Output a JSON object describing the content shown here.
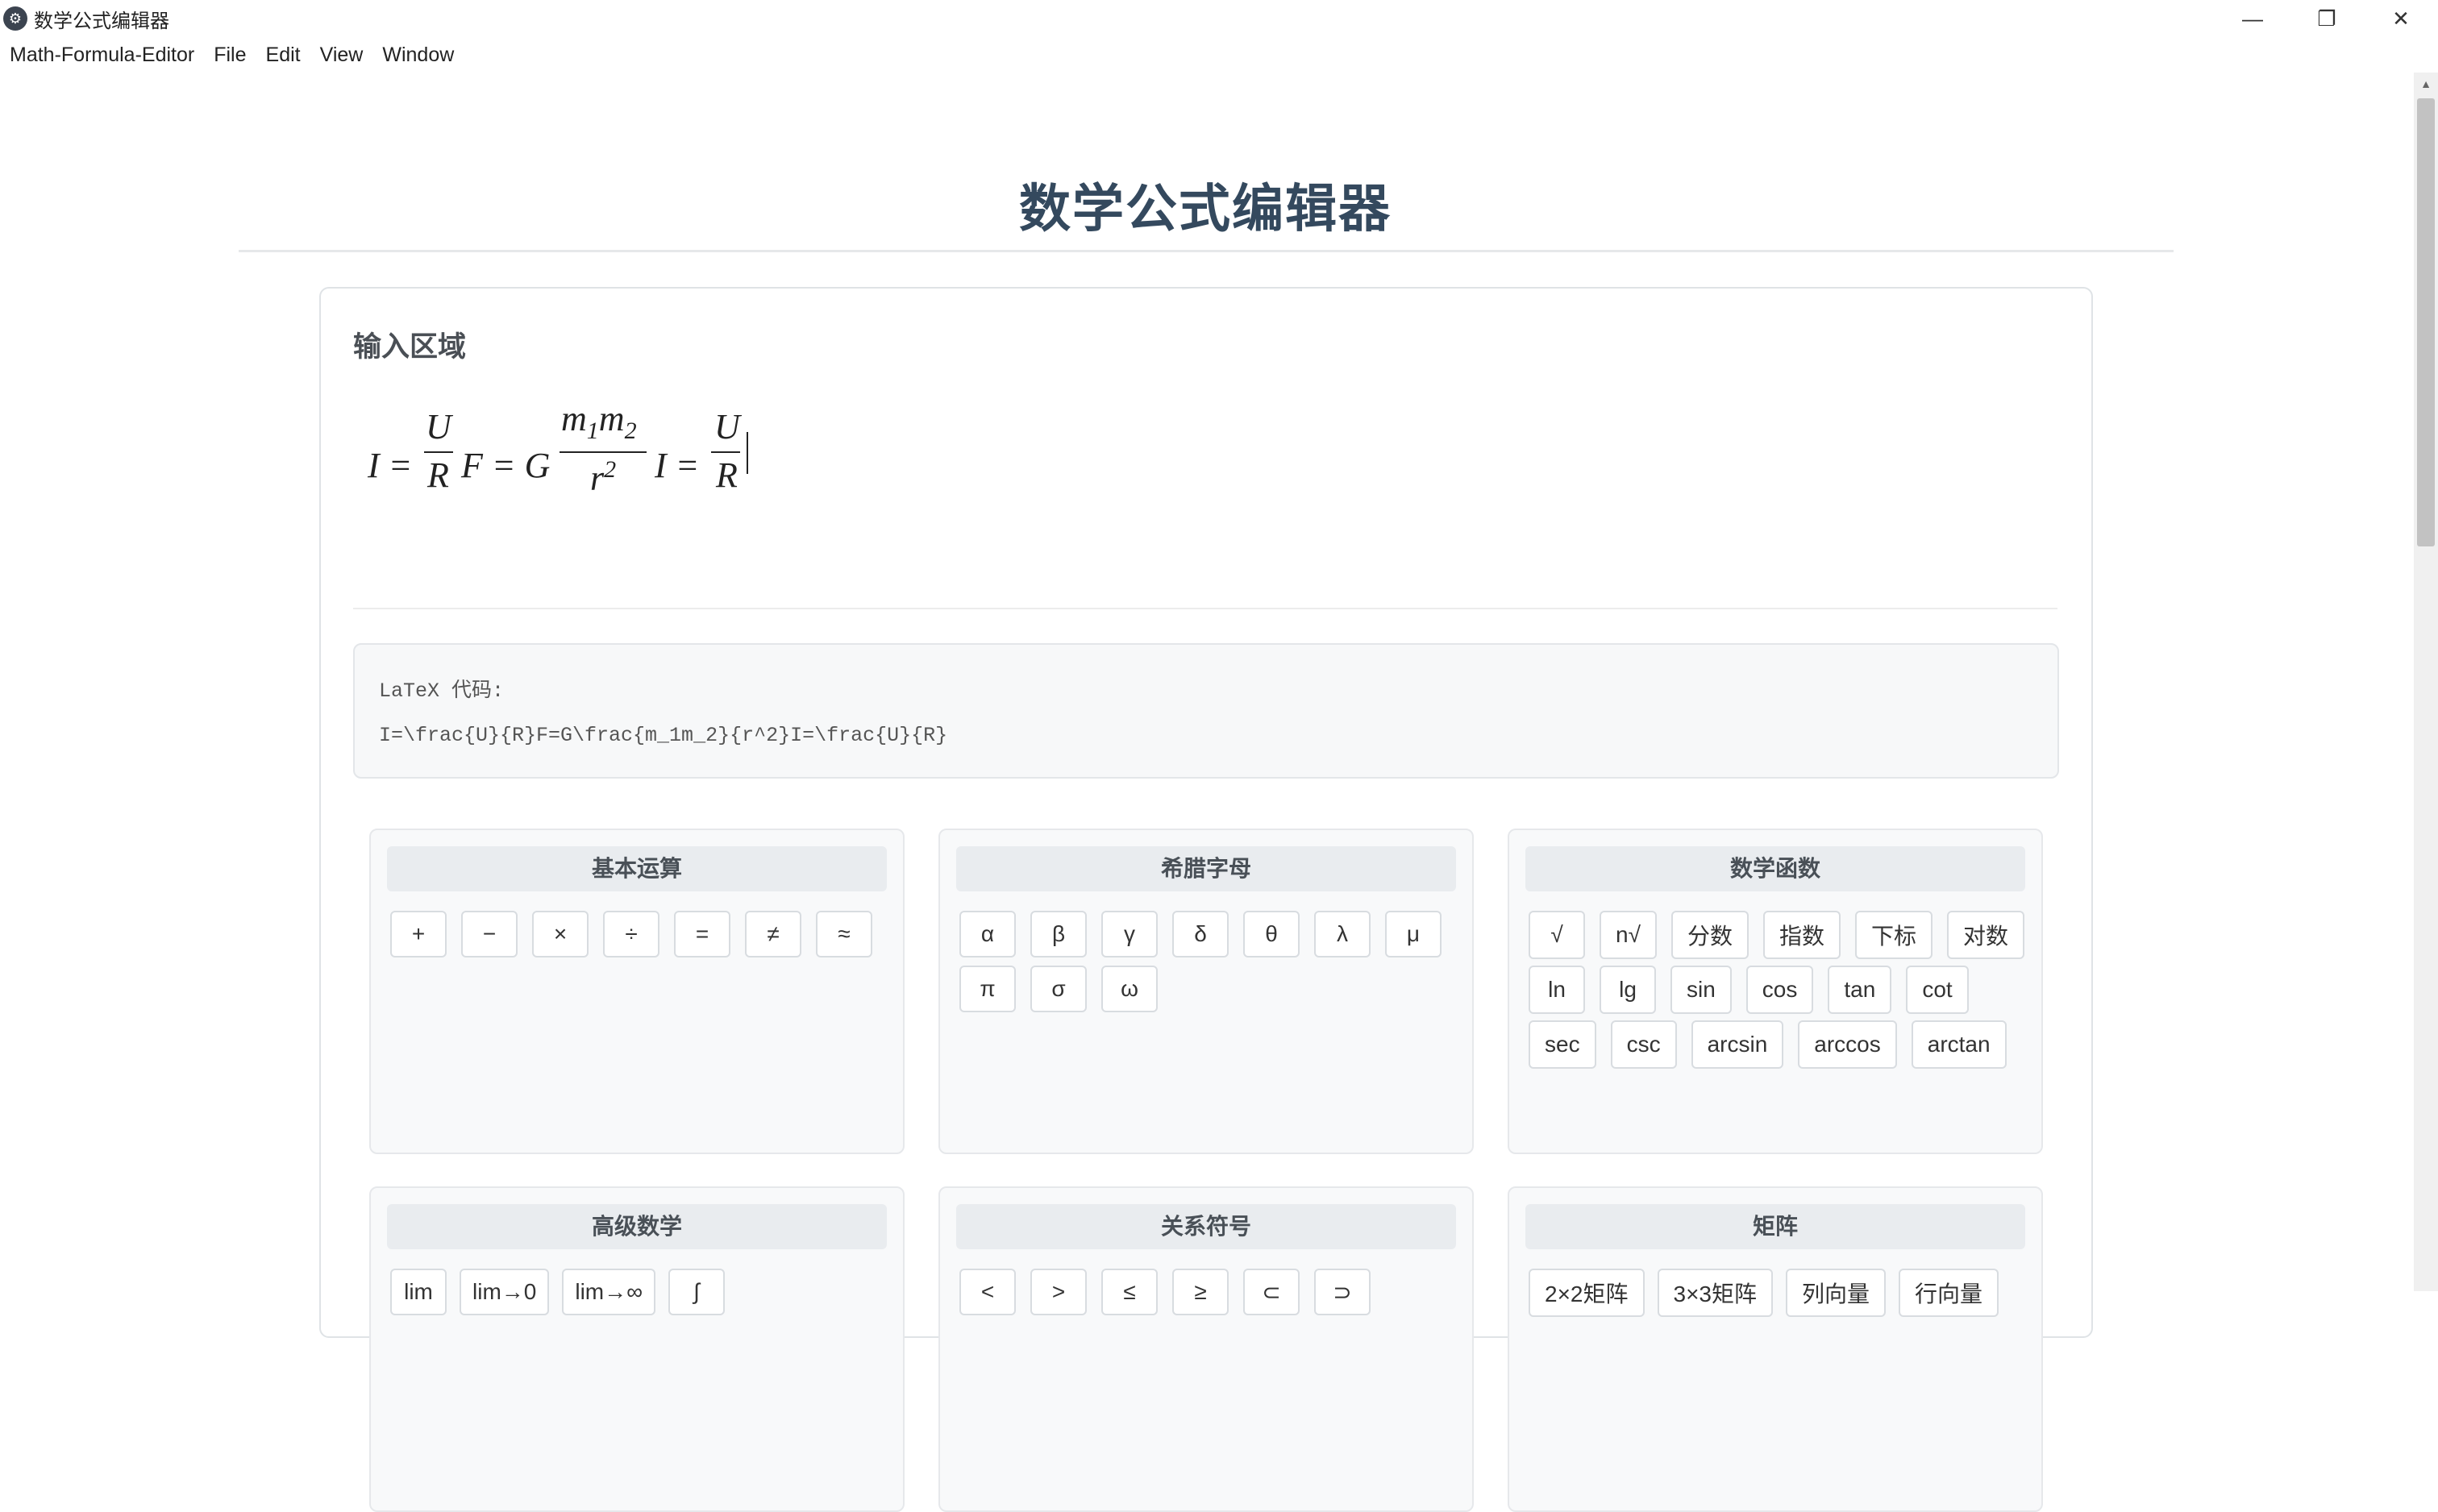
{
  "window": {
    "title": "数学公式编辑器",
    "controls": {
      "minimize": "—",
      "restore": "❐",
      "close": "✕"
    }
  },
  "menubar": {
    "items": [
      "Math-Formula-Editor",
      "File",
      "Edit",
      "View",
      "Window"
    ]
  },
  "page": {
    "title": "数学公式编辑器"
  },
  "input_area": {
    "title": "输入区域",
    "formula": {
      "f1": {
        "lhs": "I =",
        "num": "U",
        "den": "R"
      },
      "f2": {
        "lhs": "F = G",
        "num_m": "m",
        "num_s1": "1",
        "num_m2": "m",
        "num_s2": "2",
        "den_r": "r",
        "den_exp": "2"
      },
      "f3": {
        "lhs": "I =",
        "num": "U",
        "den": "R"
      }
    }
  },
  "latex": {
    "label": "LaTeX 代码:",
    "code": "I=\\frac{U}{R}F=G\\frac{m_1m_2}{r^2}I=\\frac{U}{R}"
  },
  "panels": {
    "basic_ops": {
      "title": "基本运算",
      "buttons": [
        "+",
        "−",
        "×",
        "÷",
        "=",
        "≠",
        "≈"
      ]
    },
    "greek": {
      "title": "希腊字母",
      "buttons": [
        "α",
        "β",
        "γ",
        "δ",
        "θ",
        "λ",
        "μ",
        "π",
        "σ",
        "ω"
      ]
    },
    "functions": {
      "title": "数学函数",
      "buttons": [
        "√",
        "n√",
        "分数",
        "指数",
        "下标",
        "对数",
        "ln",
        "lg",
        "sin",
        "cos",
        "tan",
        "cot",
        "sec",
        "csc",
        "arcsin",
        "arccos",
        "arctan"
      ]
    },
    "advanced": {
      "title": "高级数学",
      "buttons": [
        "lim",
        "lim→0",
        "lim→∞",
        "∫"
      ]
    },
    "relations": {
      "title": "关系符号",
      "buttons": [
        "<",
        ">",
        "≤",
        "≥",
        "⊂",
        "⊃"
      ]
    },
    "matrix": {
      "title": "矩阵",
      "buttons": [
        "2×2矩阵",
        "3×3矩阵",
        "列向量",
        "行向量"
      ]
    }
  }
}
